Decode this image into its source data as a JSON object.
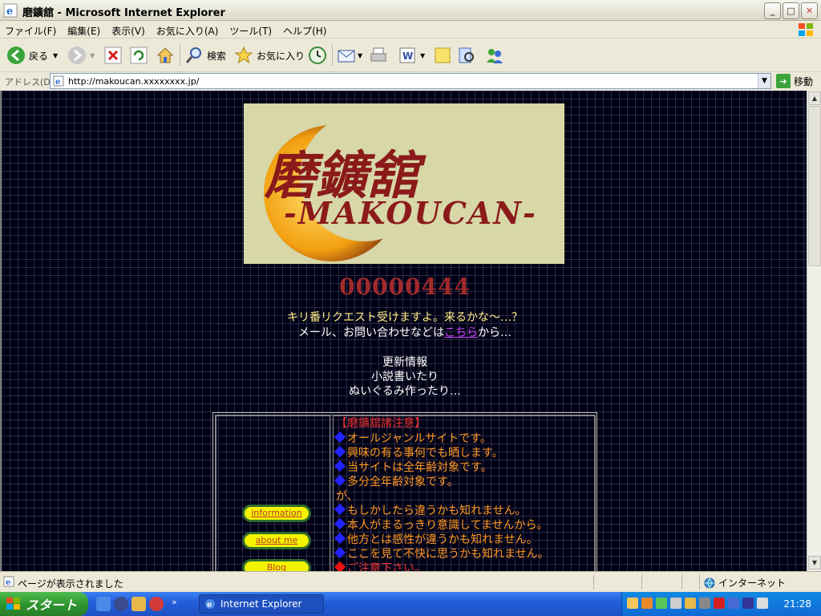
{
  "window": {
    "title": "磨鑛舘 - Microsoft Internet Explorer",
    "min": "_",
    "max": "□",
    "close": "✕"
  },
  "menu": [
    "ファイル(F)",
    "編集(E)",
    "表示(V)",
    "お気に入り(A)",
    "ツール(T)",
    "ヘルプ(H)"
  ],
  "toolbar": {
    "back": "戻る",
    "search": "検索",
    "favorites": "お気に入り"
  },
  "address": {
    "label": "アドレス(D)",
    "url": "http://makoucan.xxxxxxxx.jp/",
    "go": "移動"
  },
  "page": {
    "banner_title": "磨鑛舘",
    "banner_sub": "-MAKOUCAN-",
    "counter": "00000444",
    "line1": "キリ番リクエスト受けますよ。来るかな～…？",
    "line2_pre": "メール、お問い合わせなどは",
    "line2_link": "こちら",
    "line2_post": "から…",
    "update1": "更新情報",
    "update2": "小説書いたり",
    "update3": "ぬいぐるみ作ったり…",
    "nav": {
      "info": "information",
      "about": "about me",
      "blog": "Blog"
    },
    "notice_head": "【磨鑛舘諸注意】",
    "notices": [
      "オールジャンルサイトです。",
      "興味の有る事何でも晒します。",
      "当サイトは全年齢対象です。",
      "多分全年齢対象です。"
    ],
    "notice_ga": "が、",
    "notices2": [
      "もしかしたら違うかも知れません。",
      "本人がまるっきり意識してませんから。",
      "他方とは感性が違うかも知れません。",
      "ここを見て不快に思うかも知れません。"
    ],
    "notice_last": "ご注意下さい。"
  },
  "status": {
    "text": "ページが表示されました",
    "zone": "インターネット"
  },
  "taskbar": {
    "start": "スタート",
    "task": "Internet Explorer",
    "clock": "21:28"
  }
}
